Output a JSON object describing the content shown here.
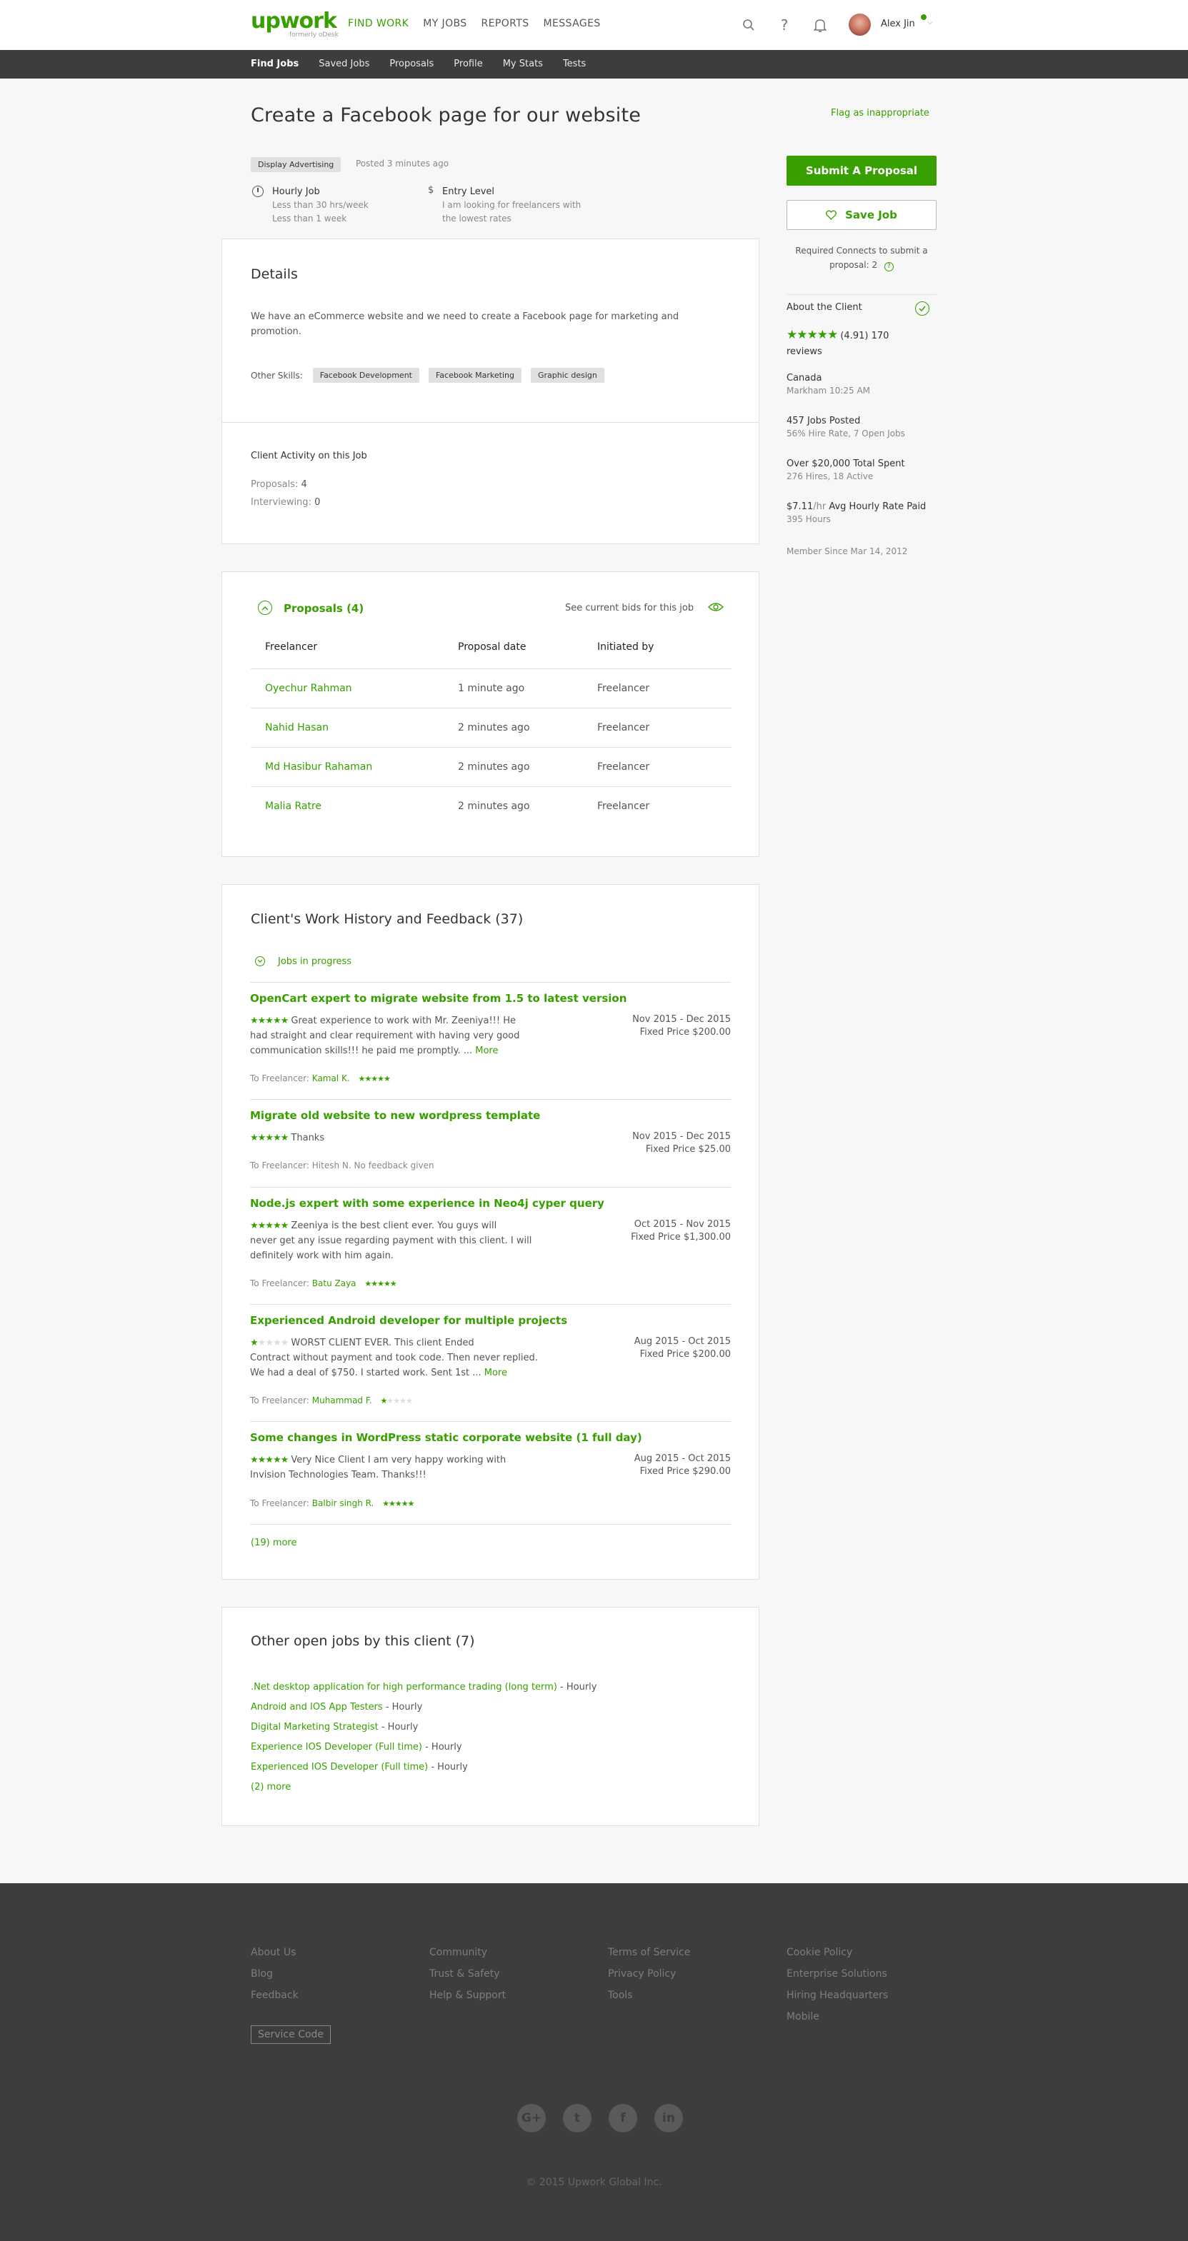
{
  "brand": {
    "logo_text": "upwork",
    "logo_sub": "formerly oDesk"
  },
  "nav": {
    "items": [
      "FIND WORK",
      "MY JOBS",
      "REPORTS",
      "MESSAGES"
    ],
    "active": "FIND WORK"
  },
  "user": {
    "name": "Alex Jin"
  },
  "subnav": {
    "items": [
      "Find Jobs",
      "Saved Jobs",
      "Proposals",
      "Profile",
      "My Stats",
      "Tests"
    ]
  },
  "job": {
    "title": "Create a Facebook page for our website",
    "flag": "Flag as inappropriate",
    "category": "Display Advertising",
    "posted": "Posted 3 minutes ago",
    "type_title": "Hourly Job",
    "type_line1": "Less than 30 hrs/week",
    "type_line2": "Less than 1 week",
    "level_title": "Entry Level",
    "level_line1": "I am looking for freelancers with",
    "level_line2": "the lowest rates",
    "details_heading": "Details",
    "description_line1": "We have an eCommerce website and we need to create a Facebook page for marketing and",
    "description_line2": "promotion.",
    "skills_label": "Other Skills:",
    "skills": [
      "Facebook Development",
      "Facebook Marketing",
      "Graphic design"
    ],
    "activity_heading": "Client Activity on this Job",
    "proposals_label": "Proposals:",
    "proposals_value": "4",
    "interviewing_label": "Interviewing:",
    "interviewing_value": "0"
  },
  "proposals": {
    "heading": "Proposals (4)",
    "see_bids": "See current bids for this job",
    "columns": [
      "Freelancer",
      "Proposal date",
      "Initiated by"
    ],
    "rows": [
      {
        "name": "Oyechur Rahman",
        "date": "1 minute ago",
        "by": "Freelancer"
      },
      {
        "name": "Nahid Hasan",
        "date": "2 minutes ago",
        "by": "Freelancer"
      },
      {
        "name": "Md Hasibur Rahaman",
        "date": "2 minutes ago",
        "by": "Freelancer"
      },
      {
        "name": "Malia Ratre",
        "date": "2 minutes ago",
        "by": "Freelancer"
      }
    ]
  },
  "history": {
    "heading": "Client's Work History and Feedback (37)",
    "in_progress": "Jobs in progress",
    "items": [
      {
        "title": "OpenCart expert to migrate website from 1.5 to latest version",
        "rating": 5,
        "line1": "Great experience to work with Mr. Zeeniya!!! He",
        "line2": "had straight and clear requirement with having very good",
        "line3": "communication skills!!! he paid me promptly. ...",
        "more": "More",
        "dates": "Nov 2015 - Dec 2015",
        "price": "Fixed Price $200.00",
        "to_label": "To Freelancer:",
        "freelancer": "Kamal K.",
        "fl_rating": 5,
        "no_feedback": ""
      },
      {
        "title": "Migrate old website to new wordpress template",
        "rating": 5,
        "line1": "Thanks",
        "line2": "",
        "line3": "",
        "more": "",
        "dates": "Nov 2015 - Dec 2015",
        "price": "Fixed Price $25.00",
        "to_label": "To Freelancer:",
        "freelancer": "",
        "fl_rating": 0,
        "no_feedback": "Hitesh N. No feedback given"
      },
      {
        "title": "Node.js expert with some experience in Neo4j cyper query",
        "rating": 5,
        "line1": "Zeeniya is the best client ever. You guys will",
        "line2": "never get any issue regarding payment with this client. I will",
        "line3": "definitely work with him again.",
        "more": "",
        "dates": "Oct 2015 - Nov 2015",
        "price": "Fixed Price $1,300.00",
        "to_label": "To Freelancer:",
        "freelancer": "Batu Zaya",
        "fl_rating": 5,
        "no_feedback": ""
      },
      {
        "title": "Experienced Android developer for multiple projects",
        "rating": 1,
        "line1": "WORST CLIENT EVER. This client Ended",
        "line2": "Contract without payment and took code. Then never replied.",
        "line3": "We had a deal of $750. I started work. Sent 1st ...",
        "more": "More",
        "dates": "Aug 2015 - Oct 2015",
        "price": "Fixed Price $200.00",
        "to_label": "To Freelancer:",
        "freelancer": "Muhammad F.",
        "fl_rating": 1,
        "no_feedback": ""
      },
      {
        "title": "Some changes in WordPress static corporate website (1 full day)",
        "rating": 5,
        "line1": "Very Nice Client I am very happy working with",
        "line2": "Invision Technologies Team. Thanks!!!",
        "line3": "",
        "more": "",
        "dates": "Aug 2015 - Oct 2015",
        "price": "Fixed Price $290.00",
        "to_label": "To Freelancer:",
        "freelancer": "Balbir singh R.",
        "fl_rating": 5,
        "no_feedback": ""
      }
    ],
    "more": "(19) more"
  },
  "other_jobs": {
    "heading": "Other open jobs by this client (7)",
    "items": [
      {
        "title": ".Net desktop application for high performance trading (long term)",
        "suffix": "- Hourly"
      },
      {
        "title": "Android and IOS App Testers",
        "suffix": "- Hourly"
      },
      {
        "title": "Digital Marketing Strategist",
        "suffix": "- Hourly"
      },
      {
        "title": "Experience IOS Developer (Full time)",
        "suffix": "- Hourly"
      },
      {
        "title": "Experienced IOS Developer (Full time)",
        "suffix": "- Hourly"
      }
    ],
    "more": "(2) more"
  },
  "sidebar": {
    "submit": "Submit A Proposal",
    "save": "Save Job",
    "connects_line1": "Required Connects to submit a",
    "connects_line2": "proposal: 2",
    "about": "About the Client",
    "rating_text": "(4.91) 170",
    "reviews": "reviews",
    "rating_value": 4.91,
    "country": "Canada",
    "city_time": "Markham 10:25 AM",
    "jobs_posted": "457 Jobs Posted",
    "hire_rate": "56% Hire Rate, 7 Open Jobs",
    "total_spent": "Over $20,000 Total Spent",
    "hires": "276 Hires, 18 Active",
    "avg_rate_value": "$7.11",
    "avg_rate_unit": "/hr",
    "avg_rate_label": "Avg Hourly Rate Paid",
    "hours": "395 Hours",
    "member_since": "Member Since Mar 14, 2012"
  },
  "footer": {
    "col1": [
      "About Us",
      "Blog",
      "Feedback"
    ],
    "col2": [
      "Community",
      "Trust & Safety",
      "Help & Support"
    ],
    "col3": [
      "Terms of Service",
      "Privacy Policy",
      "Tools"
    ],
    "col4": [
      "Cookie Policy",
      "Enterprise Solutions",
      "Hiring Headquarters",
      "Mobile"
    ],
    "service_code": "Service Code",
    "social": [
      "G+",
      "t",
      "f",
      "in"
    ],
    "copyright": "© 2015 Upwork Global Inc."
  },
  "colors": {
    "accent": "#37a000",
    "dark_bar": "#3d3d3d",
    "page_bg": "#f7f7f7"
  },
  "icons": [
    "search-icon",
    "help-icon",
    "bell-icon",
    "chevron-down-icon",
    "clock-icon",
    "dollar-icon",
    "heart-icon",
    "question-icon",
    "verified-icon",
    "chevron-up-icon",
    "eye-icon",
    "collapse-icon"
  ]
}
